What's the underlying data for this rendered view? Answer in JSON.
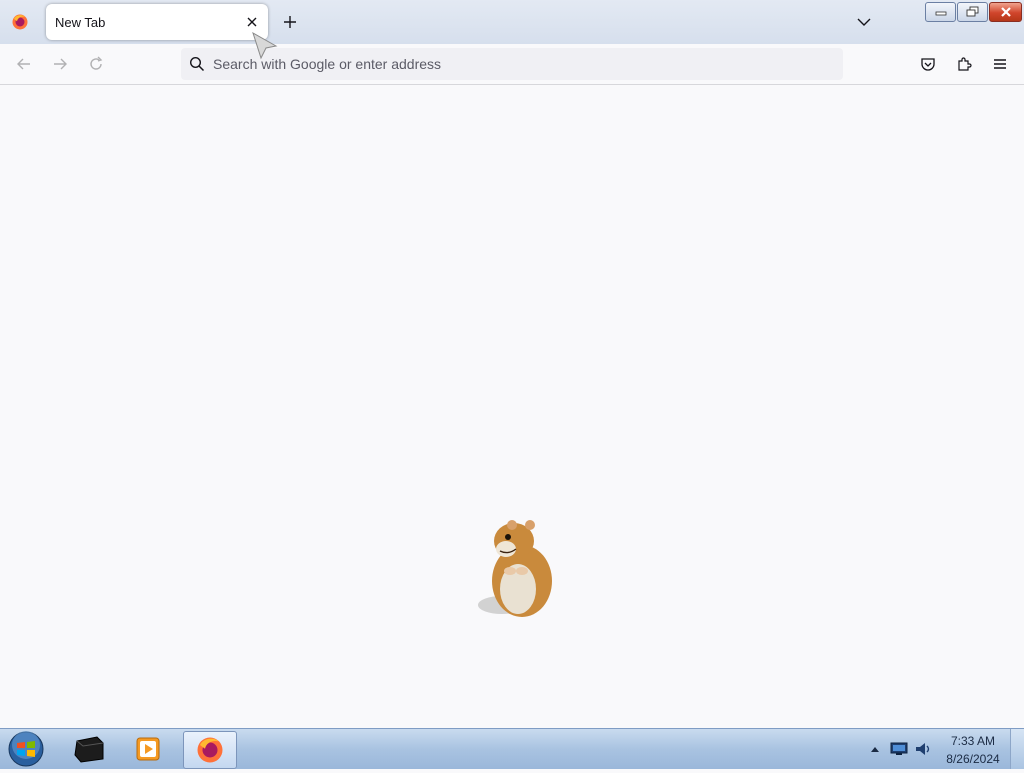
{
  "browser": {
    "tab": {
      "title": "New Tab"
    },
    "urlbar": {
      "placeholder": "Search with Google or enter address",
      "value": ""
    },
    "icons": {
      "app_menu": "firefox-icon",
      "tab_close": "close-icon",
      "new_tab": "plus-icon",
      "list_all_tabs": "chevron-down-icon",
      "back": "arrow-left-icon",
      "forward": "arrow-right-icon",
      "reload": "reload-icon",
      "search": "search-icon",
      "pocket": "pocket-icon",
      "extensions": "puzzle-icon",
      "menu": "hamburger-menu-icon"
    }
  },
  "content": {
    "image": "hamster-image"
  },
  "taskbar": {
    "start": "windows-start-icon",
    "apps": [
      "terminal-app-icon",
      "media-player-icon",
      "firefox-icon"
    ],
    "tray": [
      "show-hidden-icons-icon",
      "network-icon",
      "volume-icon"
    ],
    "clock": {
      "time": "7:33 AM",
      "date": "8/26/2024"
    }
  },
  "colors": {
    "accent_orange": "#ff7139",
    "taskbar_blue": "#a9c3e1",
    "close_red": "#d0452b"
  }
}
